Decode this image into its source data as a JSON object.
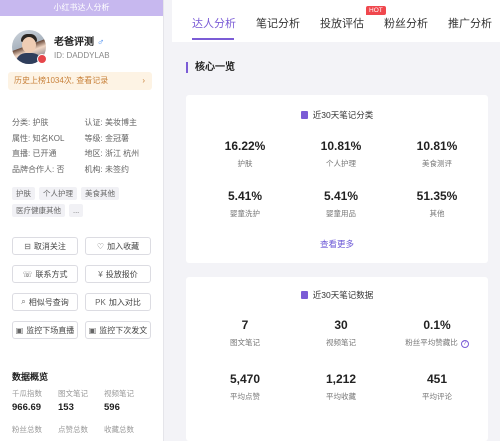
{
  "left": {
    "header": "小红书达人分析",
    "profile": {
      "name": "老爸评测",
      "gender": "♂",
      "id_label": "ID: DADDYLAB"
    },
    "history": {
      "text": "历史上榜1034次, 查看记录",
      "arrow": "›"
    },
    "attributes": [
      [
        "分类: 护肤",
        "认证: 美妆博主"
      ],
      [
        "属性: 知名KOL",
        "等级: 金冠薯"
      ],
      [
        "直播: 已开通",
        "地区: 浙江 杭州"
      ],
      [
        "品牌合作人: 否",
        "机构: 未签约"
      ]
    ],
    "tags": [
      "护肤",
      "个人护理",
      "美食其他",
      "医疗健康其他",
      "..."
    ],
    "buttons": [
      {
        "label": "取消关注",
        "icon": "minus-square-icon",
        "glyph": "⊟"
      },
      {
        "label": "加入收藏",
        "icon": "heart-icon",
        "glyph": "♡"
      },
      {
        "label": "联系方式",
        "icon": "contact-icon",
        "glyph": "☏"
      },
      {
        "label": "投放报价",
        "icon": "price-icon",
        "glyph": "¥"
      },
      {
        "label": "相似号查询",
        "icon": "search-icon",
        "glyph": "⌕"
      },
      {
        "label": "加入对比",
        "icon": "compare-icon",
        "glyph": "PK"
      },
      {
        "label": "监控下场直播",
        "icon": "monitor-live-icon",
        "glyph": "▣"
      },
      {
        "label": "监控下次发文",
        "icon": "monitor-post-icon",
        "glyph": "▣"
      }
    ],
    "overview": {
      "title": "数据概览",
      "labels": [
        "千瓜指数",
        "图文笔记",
        "视频笔记"
      ],
      "values": [
        "966.69",
        "153",
        "596"
      ],
      "labels2": [
        "粉丝总数",
        "点赞总数",
        "收藏总数"
      ]
    }
  },
  "tabs": [
    {
      "label": "达人分析",
      "active": true
    },
    {
      "label": "笔记分析",
      "active": false
    },
    {
      "label": "投放评估",
      "active": false,
      "badge": "HOT"
    },
    {
      "label": "粉丝分析",
      "active": false
    },
    {
      "label": "推广分析",
      "active": false
    }
  ],
  "main": {
    "section_title": "核心一览",
    "card1": {
      "title": "近30天笔记分类",
      "metrics": [
        {
          "value": "16.22%",
          "label": "护肤"
        },
        {
          "value": "10.81%",
          "label": "个人护理"
        },
        {
          "value": "10.81%",
          "label": "美食测评"
        },
        {
          "value": "5.41%",
          "label": "婴童洗护"
        },
        {
          "value": "5.41%",
          "label": "婴童用品"
        },
        {
          "value": "51.35%",
          "label": "其他"
        }
      ],
      "more": "查看更多"
    },
    "card2": {
      "title": "近30天笔记数据",
      "metrics": [
        {
          "value": "7",
          "label": "图文笔记"
        },
        {
          "value": "30",
          "label": "视频笔记"
        },
        {
          "value": "0.1%",
          "label": "粉丝平均赞藏比",
          "help": "?"
        },
        {
          "value": "5,470",
          "label": "平均点赞"
        },
        {
          "value": "1,212",
          "label": "平均收藏"
        },
        {
          "value": "451",
          "label": "平均评论"
        }
      ]
    }
  },
  "colors": {
    "accent": "#7b5cd6",
    "header": "#c7b8ef",
    "hot": "#f0474d",
    "history_bg": "#fdf3e4",
    "history_text": "#c8813a"
  }
}
